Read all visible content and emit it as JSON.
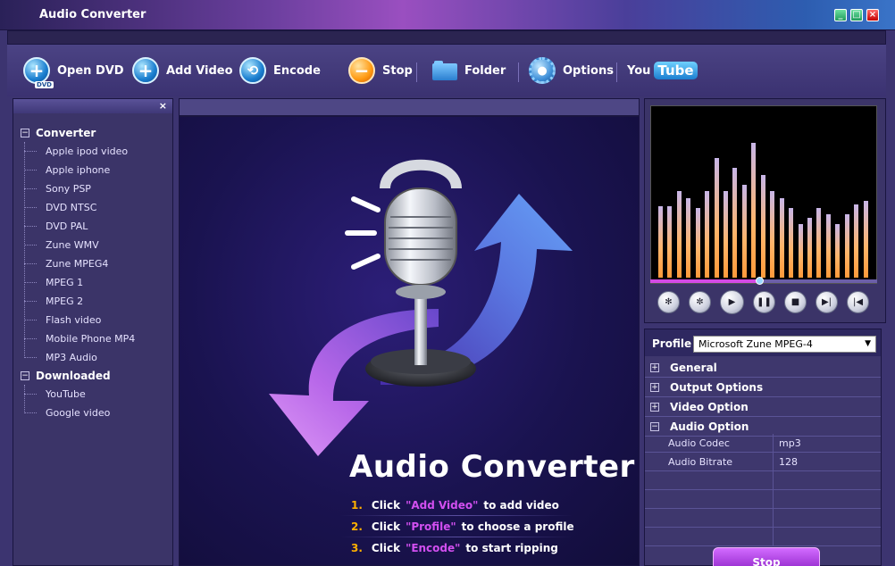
{
  "window": {
    "title": "Audio Converter"
  },
  "toolbar": {
    "open_dvd": "Open DVD",
    "dvd_badge": "DVD",
    "add_video": "Add Video",
    "encode": "Encode",
    "stop": "Stop",
    "folder": "Folder",
    "options": "Options",
    "youtube_you": "You",
    "youtube_tube": "Tube"
  },
  "sidebar": {
    "close": "×",
    "groups": [
      {
        "label": "Converter",
        "toggle": "−",
        "items": [
          "Apple ipod video",
          "Apple iphone",
          "Sony PSP",
          "DVD NTSC",
          "DVD PAL",
          "Zune WMV",
          "Zune MPEG4",
          "MPEG 1",
          "MPEG 2",
          "Flash video",
          "Mobile Phone MP4",
          "MP3 Audio"
        ]
      },
      {
        "label": "Downloaded",
        "toggle": "−",
        "items": [
          "YouTube",
          "Google video"
        ]
      }
    ]
  },
  "main": {
    "title": "Audio Converter",
    "steps": [
      {
        "num": "1.",
        "pre": "Click",
        "hl": "\"Add Video\"",
        "post": "to add video"
      },
      {
        "num": "2.",
        "pre": "Click",
        "hl": "\"Profile\"",
        "post": "to choose a profile"
      },
      {
        "num": "3.",
        "pre": "Click",
        "hl": "\"Encode\"",
        "post": "to start ripping"
      }
    ]
  },
  "player": {
    "spectrum_levels": [
      0.43,
      0.43,
      0.52,
      0.48,
      0.42,
      0.52,
      0.72,
      0.52,
      0.66,
      0.56,
      0.81,
      0.62,
      0.52,
      0.48,
      0.42,
      0.32,
      0.36,
      0.42,
      0.38,
      0.32,
      0.38,
      0.44,
      0.46
    ],
    "progress": 0.48
  },
  "properties": {
    "profile_label": "Profile",
    "profile_value": "Microsoft Zune MPEG-4",
    "sections": [
      {
        "label": "General",
        "toggle": "+"
      },
      {
        "label": "Output Options",
        "toggle": "+"
      },
      {
        "label": "Video Option",
        "toggle": "+"
      },
      {
        "label": "Audio Option",
        "toggle": "−"
      }
    ],
    "rows": [
      {
        "key": "Audio Codec",
        "value": "mp3"
      },
      {
        "key": "Audio Bitrate",
        "value": "128"
      }
    ],
    "stop_button": "Stop"
  },
  "colors": {
    "accent": "#d24ff0",
    "step_number": "#ffb000",
    "background": "#3c3470"
  }
}
